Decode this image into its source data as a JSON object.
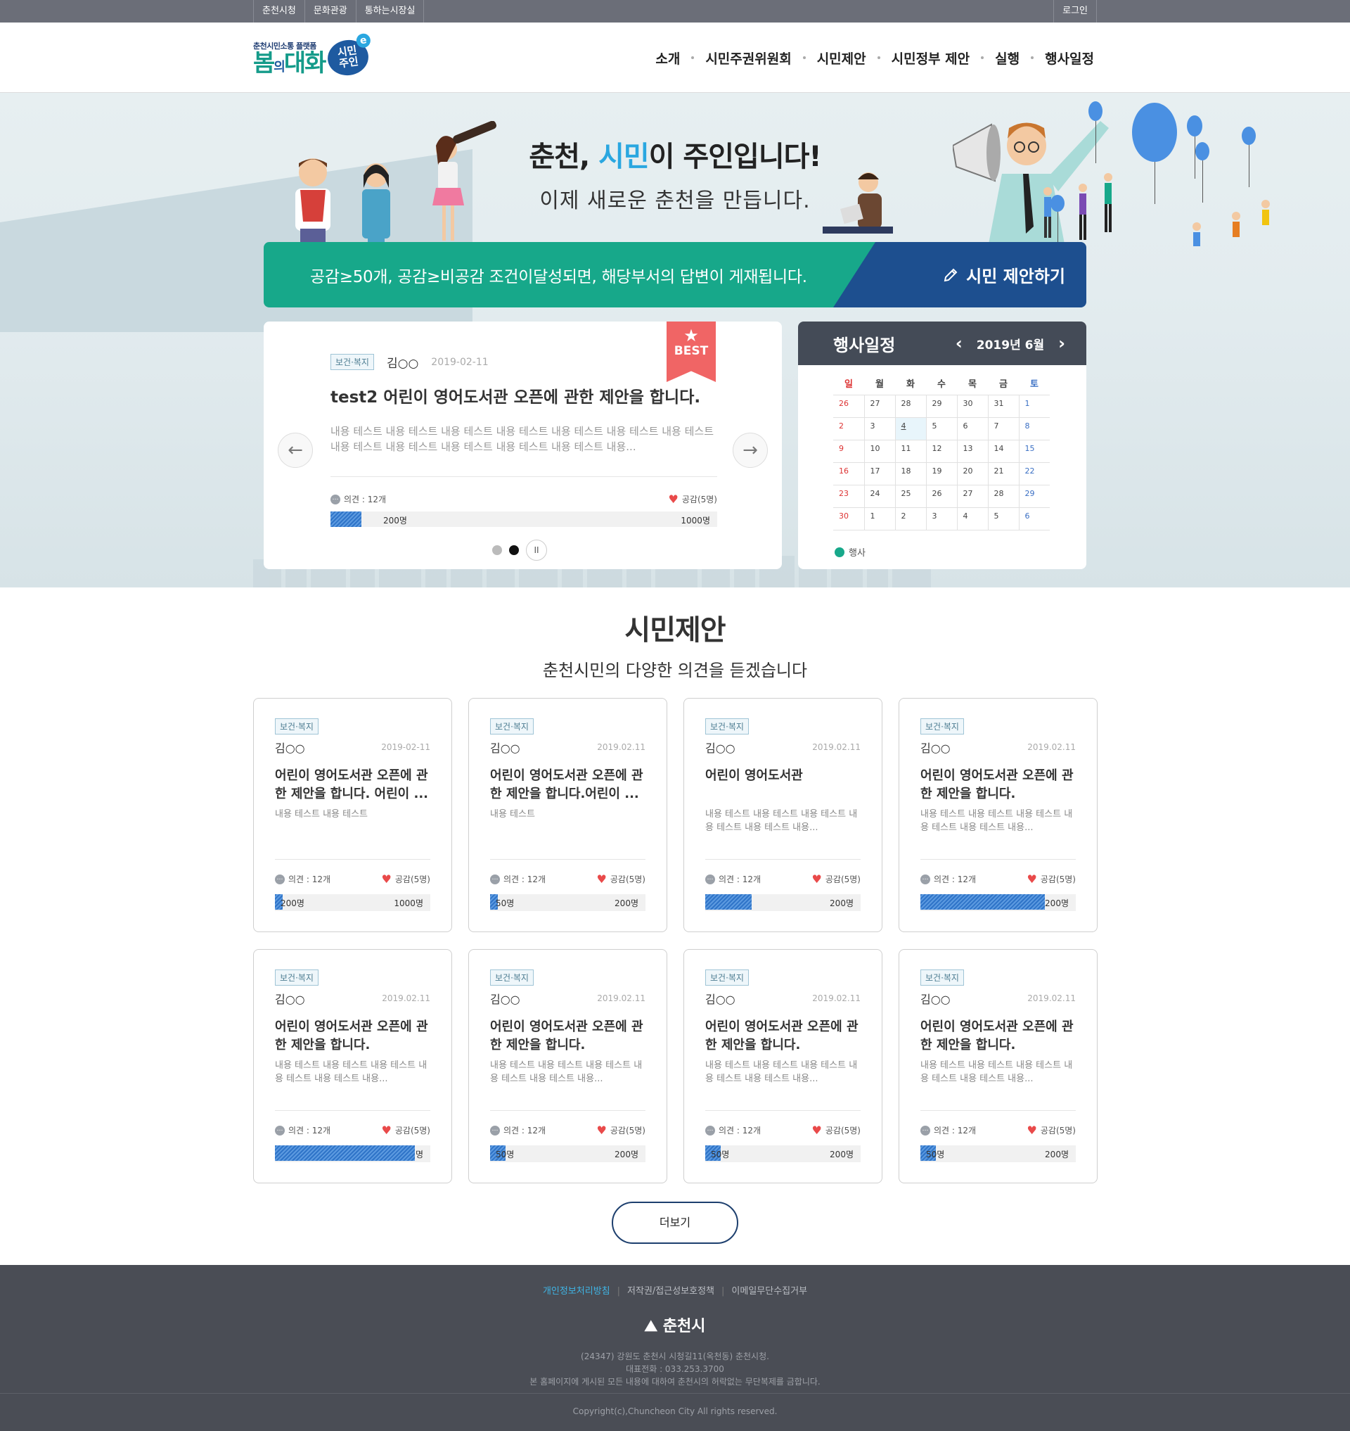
{
  "util": {
    "left": [
      "춘천시청",
      "문화관광",
      "통하는시장실"
    ],
    "right": "로그인"
  },
  "logo": {
    "small": "춘천시민소통 플랫폼",
    "big_a": "봄",
    "big_b": "의",
    "big_c": "대화",
    "badge": "시민\n주인",
    "badge_e": "e"
  },
  "nav": [
    "소개",
    "시민주권위원회",
    "시민제안",
    "시민정부 제안",
    "실행",
    "행사일정"
  ],
  "hero": {
    "title_a": "춘천, ",
    "title_hl": "시민",
    "title_b": "이 주인입니다!",
    "subtitle": "이제 새로운 춘천을 만듭니다."
  },
  "cta": {
    "notice": "공감≥50개, 공감≥비공감 조건이달성되면, 해당부서의 답변이 게재됩니다.",
    "button": "시민 제안하기"
  },
  "best": {
    "ribbon": "BEST",
    "tag": "보건·복지",
    "name": "김○○",
    "date": "2019-02-11",
    "title": "test2 어린이 영어도서관 오픈에 관한 제안을 합니다.",
    "desc": "내용 테스트 내용 테스트 내용 테스트 내용 테스트 내용 테스트 내용 테스트 내용 테스트 내용 테스트 내용 테스트 내용 테스트 내용 테스트 내용 테스트 내용...",
    "opinion": "의견 : 12개",
    "like": "공감(5명)",
    "current": "200명",
    "goal": "1000명",
    "progress": 0.08
  },
  "calendar": {
    "title": "행사일정",
    "month": "2019년 6월",
    "weekdays": [
      "일",
      "월",
      "화",
      "수",
      "목",
      "금",
      "토"
    ],
    "weeks": [
      [
        "26",
        "27",
        "28",
        "29",
        "30",
        "31",
        "1"
      ],
      [
        "2",
        "3",
        "4",
        "5",
        "6",
        "7",
        "8"
      ],
      [
        "9",
        "10",
        "11",
        "12",
        "13",
        "14",
        "15"
      ],
      [
        "16",
        "17",
        "18",
        "19",
        "20",
        "21",
        "22"
      ],
      [
        "23",
        "24",
        "25",
        "26",
        "27",
        "28",
        "29"
      ],
      [
        "30",
        "1",
        "2",
        "3",
        "4",
        "5",
        "6"
      ]
    ],
    "today": "4",
    "legend": "행사"
  },
  "section": {
    "title": "시민제안",
    "subtitle": "춘천시민의 다양한 의견을 듣겠습니다"
  },
  "cards": [
    {
      "tag": "보건·복지",
      "name": "김○○",
      "date": "2019-02-11",
      "title": "어린이 영어도서관 오픈에 관한 제안을 합니다. 어린이 ...",
      "desc": "내용 테스트 내용 테스트",
      "opinion": "의견 : 12개",
      "like": "공감(5명)",
      "current": "200명",
      "goal": "1000명",
      "progress": 0.05
    },
    {
      "tag": "보건·복지",
      "name": "김○○",
      "date": "2019.02.11",
      "title": "어린이 영어도서관 오픈에 관한 제안을 합니다.어린이 ...",
      "desc": "내용 테스트",
      "opinion": "의견 : 12개",
      "like": "공감(5명)",
      "current": "50명",
      "goal": "200명",
      "progress": 0.05
    },
    {
      "tag": "보건·복지",
      "name": "김○○",
      "date": "2019.02.11",
      "title": "어린이 영어도서관",
      "desc": "내용 테스트 내용 테스트 내용 테스트 내용 테스트 내용 테스트 내용...",
      "opinion": "의견 : 12개",
      "like": "공감(5명)",
      "current": "",
      "goal": "200명",
      "progress": 0.3
    },
    {
      "tag": "보건·복지",
      "name": "김○○",
      "date": "2019.02.11",
      "title": "어린이 영어도서관 오픈에 관한 제안을 합니다.",
      "desc": "내용 테스트 내용 테스트 내용 테스트 내용 테스트 내용 테스트 내용...",
      "opinion": "의견 : 12개",
      "like": "공감(5명)",
      "current": "",
      "goal": "200명",
      "progress": 0.8
    },
    {
      "tag": "보건·복지",
      "name": "김○○",
      "date": "2019.02.11",
      "title": "어린이 영어도서관 오픈에 관한 제안을 합니다.",
      "desc": "내용 테스트 내용 테스트 내용 테스트 내용 테스트 내용 테스트 내용...",
      "opinion": "의견 : 12개",
      "like": "공감(5명)",
      "current": "",
      "goal": "명",
      "progress": 0.9
    },
    {
      "tag": "보건·복지",
      "name": "김○○",
      "date": "2019.02.11",
      "title": "어린이 영어도서관 오픈에 관한 제안을 합니다.",
      "desc": "내용 테스트 내용 테스트 내용 테스트 내용 테스트 내용 테스트 내용...",
      "opinion": "의견 : 12개",
      "like": "공감(5명)",
      "current": "50명",
      "goal": "200명",
      "progress": 0.1
    },
    {
      "tag": "보건·복지",
      "name": "김○○",
      "date": "2019.02.11",
      "title": "어린이 영어도서관 오픈에 관한 제안을 합니다.",
      "desc": "내용 테스트 내용 테스트 내용 테스트 내용 테스트 내용 테스트 내용...",
      "opinion": "의견 : 12개",
      "like": "공감(5명)",
      "current": "50명",
      "goal": "200명",
      "progress": 0.1
    },
    {
      "tag": "보건·복지",
      "name": "김○○",
      "date": "2019.02.11",
      "title": "어린이 영어도서관 오픈에 관한 제안을 합니다.",
      "desc": "내용 테스트 내용 테스트 내용 테스트 내용 테스트 내용 테스트 내용...",
      "opinion": "의견 : 12개",
      "like": "공감(5명)",
      "current": "50명",
      "goal": "200명",
      "progress": 0.1
    }
  ],
  "more": "더보기",
  "footer": {
    "links": [
      "개인정보처리방침",
      "저작권/접근성보호정책",
      "이메일무단수집거부"
    ],
    "logo": "춘천시",
    "address": "(24347) 강원도 춘천시 시청길11(옥천동) 춘천시청.",
    "phone": "대표전화 : 033.253.3700",
    "notice": "본 홈페이지에 게시된 모든 내용에 대하여 춘천시의 허락없는 무단복제를 금합니다.",
    "copyright": "Copyright(c),Chuncheon City All rights reserved."
  },
  "colors": {
    "green": "#17a88a",
    "navy": "#1d4f8f",
    "accent_blue": "#2aa7e0",
    "ribbon": "#f06565",
    "footer": "#4a4d55"
  },
  "icons": [
    "pencil-icon",
    "star-icon",
    "chat-icon",
    "heart-icon",
    "arrow-left-icon",
    "arrow-right-icon",
    "chevron-left-icon",
    "chevron-right-icon",
    "pause-icon"
  ]
}
